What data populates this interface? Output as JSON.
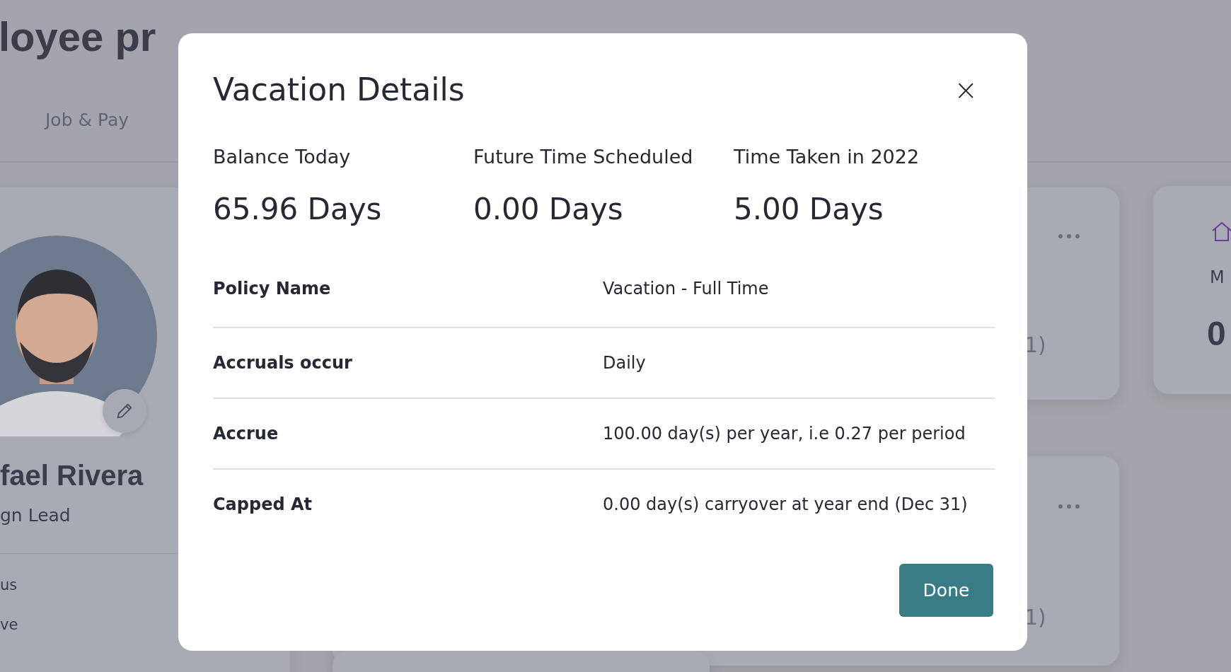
{
  "background": {
    "page_title": "loyee pr",
    "tabs": [
      {
        "label": "Job & Pay"
      }
    ],
    "profile": {
      "name": "fael Rivera",
      "role": "gn Lead",
      "fields": [
        "us",
        "ve"
      ]
    },
    "cards": [
      {
        "text": "1)"
      },
      {
        "text": "1)"
      }
    ],
    "home_card": {
      "label": "M",
      "value": "0"
    }
  },
  "dialog": {
    "title": "Vacation Details",
    "close": "×",
    "stats": [
      {
        "label": "Balance Today",
        "value": "65.96 Days"
      },
      {
        "label": "Future Time Scheduled",
        "value": "0.00 Days"
      },
      {
        "label": "Time Taken in 2022",
        "value": "5.00 Days"
      }
    ],
    "rows": [
      {
        "label": "Policy Name",
        "value": "Vacation - Full Time"
      },
      {
        "label": "Accruals occur",
        "value": "Daily"
      },
      {
        "label": "Accrue",
        "value": "100.00 day(s) per year, i.e 0.27 per period"
      },
      {
        "label": "Capped At",
        "value": "0.00 day(s) carryover at year end (Dec 31)"
      }
    ],
    "button": "Done"
  }
}
